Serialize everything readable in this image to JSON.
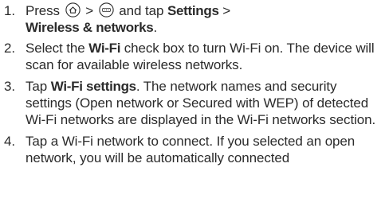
{
  "steps": [
    {
      "num": "1.",
      "a": "Press",
      "gt1": ">",
      "b": "and tap",
      "settings": "Settings",
      "gt2": ">",
      "wireless": "Wireless & networks",
      "period": ".",
      "icons": [
        "home-icon",
        "menu-icon"
      ]
    },
    {
      "num": "2.",
      "a": "Select the",
      "wifi": "Wi-Fi",
      "b": "check box to turn Wi-Fi on. The device will scan for available wireless networks."
    },
    {
      "num": "3.",
      "a": "Tap",
      "wifi_settings": "Wi-Fi settings",
      "b": ". The network names and security settings (Open network or Secured with WEP) of detected Wi-Fi networks are displayed in the Wi-Fi networks section."
    },
    {
      "num": "4.",
      "text": "Tap a Wi-Fi network to connect. If you selected an open network, you will be automatically connected"
    }
  ]
}
